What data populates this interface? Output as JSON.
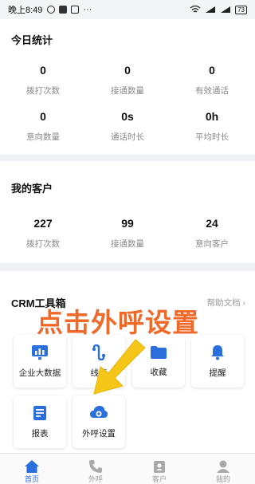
{
  "status_bar": {
    "time": "晚上8:49",
    "dots": "···",
    "battery": "73"
  },
  "today": {
    "title": "今日统计",
    "stats": [
      {
        "value": "0",
        "label": "拨打次数"
      },
      {
        "value": "0",
        "label": "接通数量"
      },
      {
        "value": "0",
        "label": "有效通话"
      },
      {
        "value": "0",
        "label": "意向数量"
      },
      {
        "value": "0s",
        "label": "通话时长"
      },
      {
        "value": "0h",
        "label": "平均时长"
      }
    ]
  },
  "customers": {
    "title": "我的客户",
    "stats": [
      {
        "value": "227",
        "label": "拨打次数"
      },
      {
        "value": "99",
        "label": "接通数量"
      },
      {
        "value": "24",
        "label": "意向客户"
      }
    ]
  },
  "toolbox": {
    "title": "CRM工具箱",
    "doc_link": "帮助文档",
    "chevron": "›",
    "items": [
      {
        "label": "企业大数据",
        "icon": "chart-icon"
      },
      {
        "label": "线索",
        "icon": "clue-icon"
      },
      {
        "label": "收藏",
        "icon": "folder-icon"
      },
      {
        "label": "提醒",
        "icon": "bell-icon"
      },
      {
        "label": "报表",
        "icon": "report-icon"
      },
      {
        "label": "外呼设置",
        "icon": "cloud-settings-icon"
      }
    ]
  },
  "overlay": {
    "text": "点击外呼设置",
    "color": "#ef6a2a",
    "arrow_color": "#f5c518"
  },
  "tabs": [
    {
      "label": "首页",
      "icon": "home-icon",
      "active": true
    },
    {
      "label": "外呼",
      "icon": "phone-icon"
    },
    {
      "label": "客户",
      "icon": "contact-icon"
    },
    {
      "label": "我的",
      "icon": "user-icon"
    }
  ],
  "colors": {
    "accent": "#2a6fdb",
    "background": "#eef0f3"
  }
}
